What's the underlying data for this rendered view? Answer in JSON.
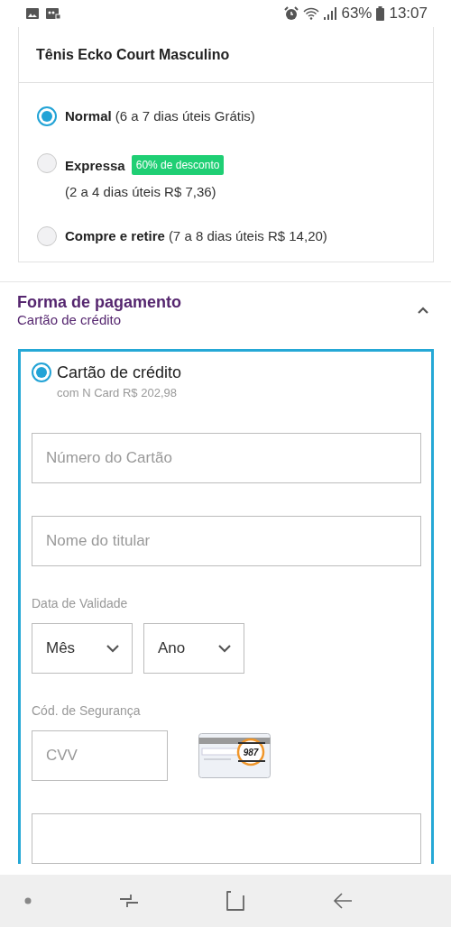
{
  "status_bar": {
    "battery": "63%",
    "time": "13:07"
  },
  "shipping": {
    "product": "Tênis Ecko Court Masculino",
    "options": [
      {
        "name": "Normal",
        "detail": "(6 a 7 dias úteis Grátis)",
        "selected": true
      },
      {
        "name": "Expressa",
        "badge": "60% de desconto",
        "detail": "(2 a 4 dias úteis R$ 7,36)",
        "selected": false
      },
      {
        "name": "Compre e retire",
        "detail": "(7 a 8 dias úteis R$ 14,20)",
        "selected": false
      }
    ]
  },
  "payment": {
    "title": "Forma de pagamento",
    "subtitle": "Cartão de crédito",
    "expanded": true,
    "method": {
      "label": "Cartão de crédito",
      "note": "com N Card R$ 202,98",
      "selected": true
    },
    "form": [
      {
        "kind": "text",
        "placeholder": "Número do Cartão"
      },
      {
        "kind": "text",
        "placeholder": "Nome do titular"
      },
      {
        "kind": "label",
        "text": "Data de Validade"
      },
      {
        "kind": "selects",
        "options": [
          {
            "placeholder": "Mês"
          },
          {
            "placeholder": "Ano"
          }
        ]
      },
      {
        "kind": "label",
        "text": "Cód. de Segurança"
      },
      {
        "kind": "cvv",
        "placeholder": "CVV",
        "hint": "987"
      },
      {
        "kind": "text"
      }
    ]
  }
}
